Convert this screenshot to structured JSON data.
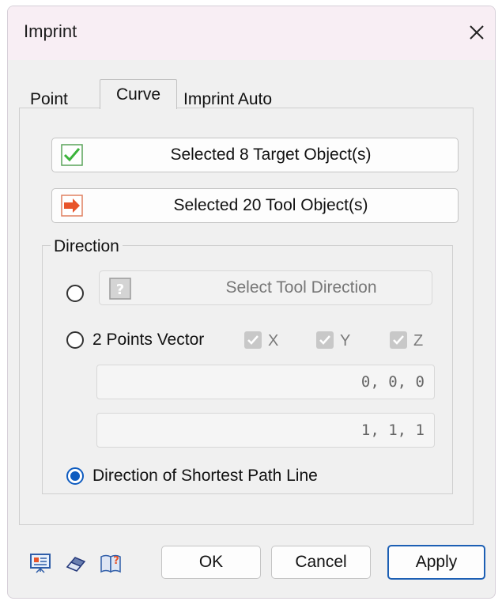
{
  "window": {
    "title": "Imprint"
  },
  "tabs": [
    {
      "label": "Point",
      "selected": false
    },
    {
      "label": "Curve",
      "selected": true
    },
    {
      "label": "Imprint Auto",
      "selected": false
    }
  ],
  "target_button": {
    "label": "Selected 8 Target Object(s)",
    "icon": "check-icon",
    "icon_color": "#3cb43c"
  },
  "tool_button": {
    "label": "Selected 20 Tool Object(s)",
    "icon": "arrow-right-icon",
    "icon_color": "#e8542a"
  },
  "direction": {
    "title": "Direction",
    "select_tool_direction": {
      "label": "Select Tool Direction",
      "icon": "question-icon",
      "checked": false
    },
    "two_points": {
      "label": "2 Points Vector",
      "checked": false,
      "axes": [
        {
          "label": "X",
          "checked": true
        },
        {
          "label": "Y",
          "checked": true
        },
        {
          "label": "Z",
          "checked": true
        }
      ],
      "start": "0, 0, 0",
      "end": "1, 1, 1"
    },
    "shortest_path": {
      "label": "Direction of Shortest Path Line",
      "checked": true
    }
  },
  "footer": {
    "icons": [
      "presentation-icon",
      "eraser-icon",
      "help-book-icon"
    ],
    "ok": "OK",
    "cancel": "Cancel",
    "apply": "Apply"
  },
  "colors": {
    "accent": "#1c5fb4",
    "titlebar": "#f8eef4"
  }
}
